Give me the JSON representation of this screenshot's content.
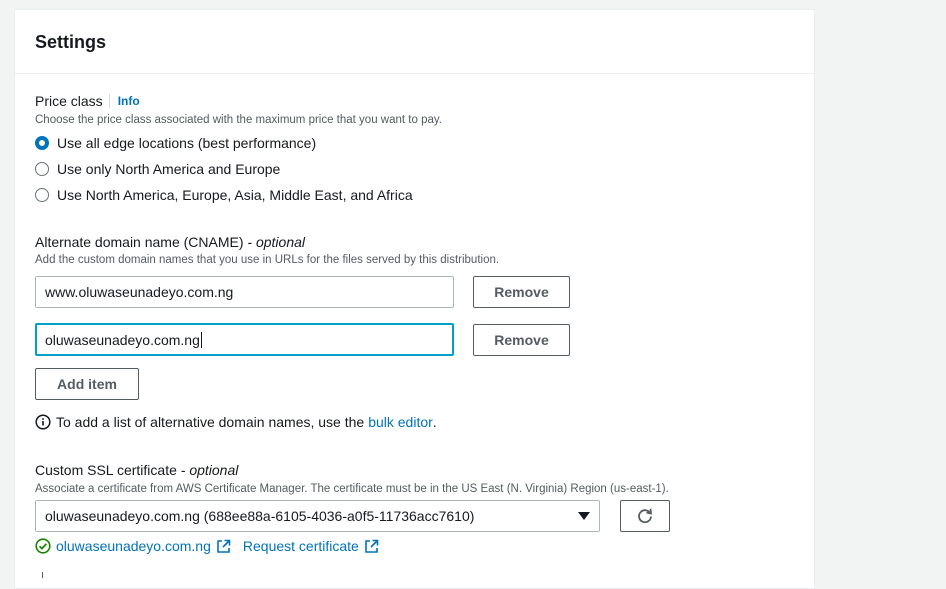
{
  "settings": {
    "title": "Settings"
  },
  "price_class": {
    "label": "Price class",
    "info": "Info",
    "description": "Choose the price class associated with the maximum price that you want to pay.",
    "options": [
      {
        "label": "Use all edge locations (best performance)",
        "checked": true
      },
      {
        "label": "Use only North America and Europe",
        "checked": false
      },
      {
        "label": "Use North America, Europe, Asia, Middle East, and Africa",
        "checked": false
      }
    ]
  },
  "cname": {
    "label": "Alternate domain name (CNAME)",
    "label_suffix": "- optional",
    "description": "Add the custom domain names that you use in URLs for the files served by this distribution.",
    "items": [
      {
        "value": "www.oluwaseunadeyo.com.ng",
        "remove_label": "Remove"
      },
      {
        "value": "oluwaseunadeyo.com.ng",
        "remove_label": "Remove"
      }
    ],
    "add_item_label": "Add item",
    "hint_prefix": "To add a list of alternative domain names, use the",
    "hint_link": "bulk editor",
    "hint_suffix": "."
  },
  "ssl": {
    "label": "Custom SSL certificate",
    "label_suffix": "- optional",
    "description": "Associate a certificate from AWS Certificate Manager. The certificate must be in the US East (N. Virginia) Region (us-east-1).",
    "selected": "oluwaseunadeyo.com.ng (688ee88a-6105-4036-a0f5-11736acc7610)",
    "cert_link": "oluwaseunadeyo.com.ng",
    "request_link": "Request certificate"
  },
  "colors": {
    "accent": "#0073bb",
    "focus": "#00a1c9",
    "success": "#1d8102"
  }
}
